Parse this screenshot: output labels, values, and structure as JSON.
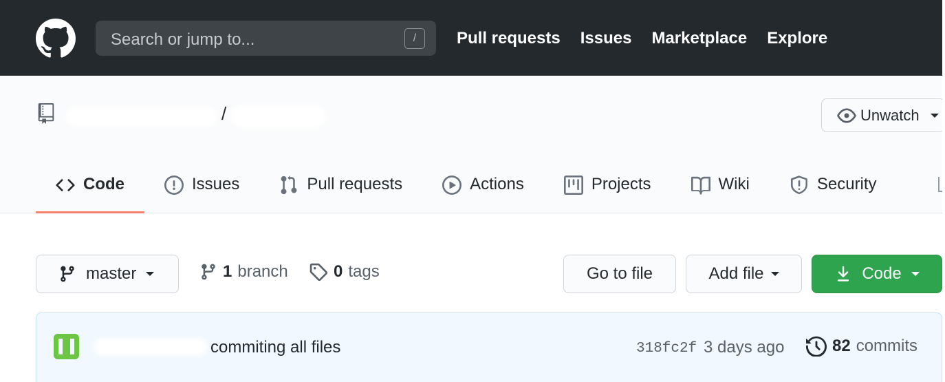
{
  "header": {
    "search_placeholder": "Search or jump to...",
    "search_shortcut": "/",
    "nav": [
      "Pull requests",
      "Issues",
      "Marketplace",
      "Explore"
    ],
    "logo": "github-octocat-icon"
  },
  "repo": {
    "separator": "/",
    "watch_label": "Unwatch",
    "tabs": [
      {
        "label": "Code",
        "icon": "code-icon",
        "active": true
      },
      {
        "label": "Issues",
        "icon": "issue-opened-icon",
        "active": false
      },
      {
        "label": "Pull requests",
        "icon": "git-pull-request-icon",
        "active": false
      },
      {
        "label": "Actions",
        "icon": "play-icon",
        "active": false
      },
      {
        "label": "Projects",
        "icon": "project-icon",
        "active": false
      },
      {
        "label": "Wiki",
        "icon": "book-icon",
        "active": false
      },
      {
        "label": "Security",
        "icon": "shield-icon",
        "active": false
      }
    ],
    "active_tab_color": "#f9826c"
  },
  "branch_bar": {
    "branch": "master",
    "branch_count": "1",
    "branch_word": "branch",
    "tag_count": "0",
    "tag_word": "tags",
    "go_to_file": "Go to file",
    "add_file": "Add file",
    "code": "Code"
  },
  "latest_commit": {
    "message": "commiting all files",
    "sha": "318fc2f",
    "time": "3 days ago",
    "commit_count": "82",
    "commit_word": "commits"
  },
  "colors": {
    "header_bg": "#24292e",
    "primary_green": "#2ea44f",
    "commit_bg": "#f1f8ff"
  }
}
